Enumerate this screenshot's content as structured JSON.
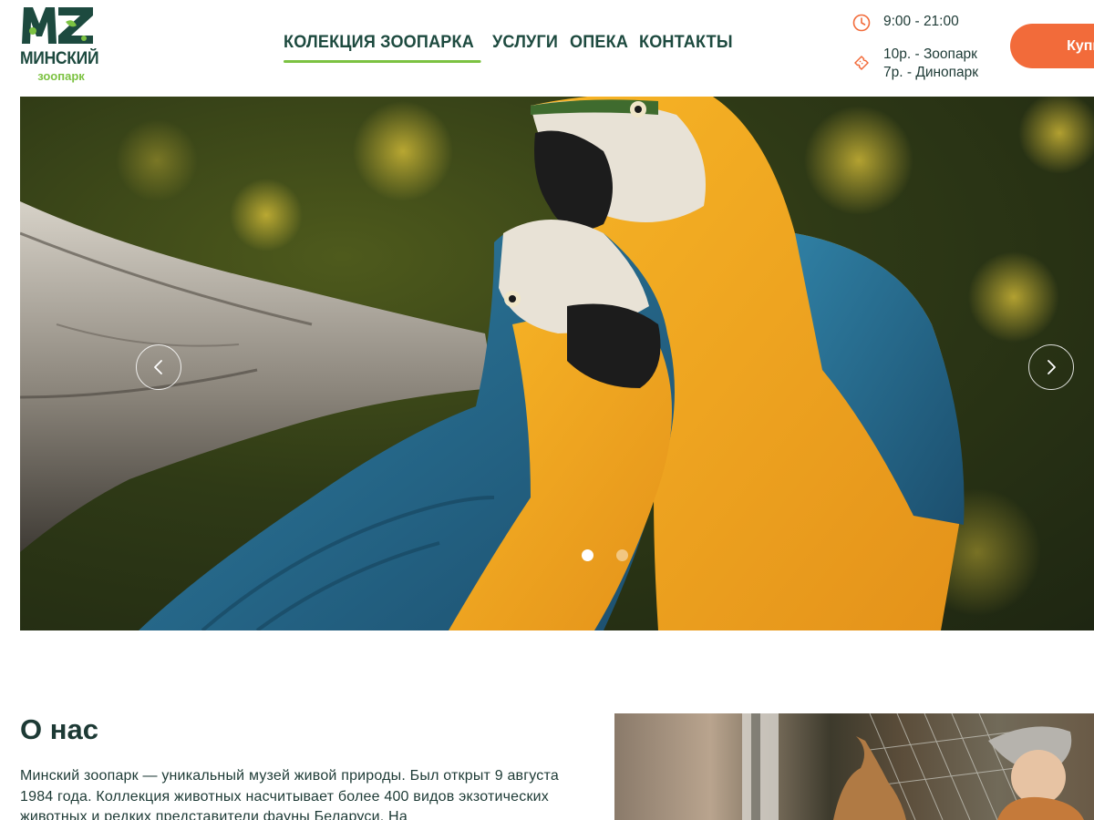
{
  "header": {
    "logo": {
      "title": "МИНСКИЙ",
      "subtitle": "зоопарк"
    },
    "nav": [
      {
        "label": "КОЛЕКЦИЯ ЗООПАРКА",
        "active": true
      },
      {
        "label": "УСЛУГИ",
        "active": false
      },
      {
        "label": "ОПЕКА",
        "active": false
      },
      {
        "label": "КОНТАКТЫ",
        "active": false
      }
    ],
    "hours": "9:00 - 21:00",
    "prices": [
      "10р. - Зоопарк",
      "7р. - Динопарк"
    ],
    "buy_label": "Купить",
    "icons": {
      "hours": "clock-icon",
      "prices": "ticket-icon"
    }
  },
  "hero": {
    "slides_total": 2,
    "active_slide": 1,
    "prev_icon": "chevron-left-icon",
    "next_icon": "chevron-right-icon"
  },
  "about": {
    "title": "О нас",
    "text": "Минский зоопарк — уникальный музей живой природы. Был открыт 9 августа 1984 года. Коллекция животных насчитывает более 400 видов экзотических животных и редких представители фауны Беларуси. На"
  },
  "colors": {
    "accent_green": "#7cc242",
    "dark_green": "#1d4a3f",
    "orange": "#f26b3a"
  }
}
